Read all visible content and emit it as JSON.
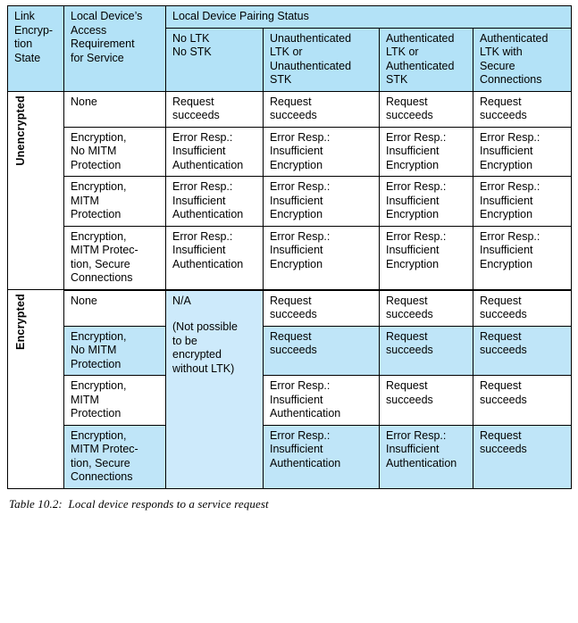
{
  "table": {
    "group_header": "Local Device Pairing Status",
    "columns": [
      {
        "key": "state",
        "label": "Link\nEncryp-\ntion\nState"
      },
      {
        "key": "access",
        "label": "Local Device’s\nAccess\nRequirement\nfor Service"
      },
      {
        "key": "no_ltk",
        "label": "No LTK\nNo STK"
      },
      {
        "key": "unauth",
        "label": "Unauthenticated\nLTK or\nUnauthenticated\nSTK"
      },
      {
        "key": "auth",
        "label": "Authenticated\nLTK or\nAuthenticated\nSTK"
      },
      {
        "key": "sc",
        "label": "Authenticated\nLTK with\nSecure\nConnections"
      }
    ],
    "sections": [
      {
        "state_label": "Unencrypted",
        "na_cell": null,
        "rows": [
          {
            "requirement": "None",
            "requirement_highlight": false,
            "cells": [
              {
                "text": "Request\nsucceeds",
                "highlight": false
              },
              {
                "text": "Request\nsucceeds",
                "highlight": false
              },
              {
                "text": "Request\nsucceeds",
                "highlight": false
              },
              {
                "text": "Request\nsucceeds",
                "highlight": false
              }
            ]
          },
          {
            "requirement": "Encryption,\nNo MITM\nProtection",
            "requirement_highlight": false,
            "cells": [
              {
                "text": "Error Resp.:\nInsufficient\nAuthentication",
                "highlight": false
              },
              {
                "text": "Error Resp.:\nInsufficient\nEncryption",
                "highlight": false
              },
              {
                "text": "Error Resp.:\nInsufficient\nEncryption",
                "highlight": false
              },
              {
                "text": "Error Resp.:\nInsufficient\nEncryption",
                "highlight": false
              }
            ]
          },
          {
            "requirement": "Encryption,\nMITM\nProtection",
            "requirement_highlight": false,
            "cells": [
              {
                "text": "Error Resp.:\nInsufficient\nAuthentication",
                "highlight": false
              },
              {
                "text": "Error Resp.:\nInsufficient\nEncryption",
                "highlight": false
              },
              {
                "text": "Error Resp.:\nInsufficient\nEncryption",
                "highlight": false
              },
              {
                "text": "Error Resp.:\nInsufficient\nEncryption",
                "highlight": false
              }
            ]
          },
          {
            "requirement": "Encryption,\nMITM Protec-\ntion, Secure\nConnections",
            "requirement_highlight": false,
            "cells": [
              {
                "text": "Error Resp.:\nInsufficient\nAuthentication",
                "highlight": false
              },
              {
                "text": "Error Resp.:\nInsufficient\nEncryption",
                "highlight": false
              },
              {
                "text": "Error Resp.:\nInsufficient\nEncryption",
                "highlight": false
              },
              {
                "text": "Error Resp.:\nInsufficient\nEncryption",
                "highlight": false
              }
            ]
          }
        ]
      },
      {
        "state_label": "Encrypted",
        "na_cell": "N/A",
        "na_note": "(Not possible\nto be\nencrypted\nwithout LTK)",
        "rows": [
          {
            "requirement": "None",
            "requirement_highlight": false,
            "cells": [
              {
                "text": "Request\nsucceeds",
                "highlight": false
              },
              {
                "text": "Request\nsucceeds",
                "highlight": false
              },
              {
                "text": "Request\nsucceeds",
                "highlight": false
              }
            ]
          },
          {
            "requirement": "Encryption,\nNo MITM\nProtection",
            "requirement_highlight": true,
            "cells": [
              {
                "text": "Request\nsucceeds",
                "highlight": true
              },
              {
                "text": "Request\nsucceeds",
                "highlight": true
              },
              {
                "text": "Request\nsucceeds",
                "highlight": true
              }
            ]
          },
          {
            "requirement": "Encryption,\nMITM\nProtection",
            "requirement_highlight": false,
            "cells": [
              {
                "text": "Error Resp.:\nInsufficient\nAuthentication",
                "highlight": false
              },
              {
                "text": "Request\nsucceeds",
                "highlight": false
              },
              {
                "text": "Request\nsucceeds",
                "highlight": false
              }
            ]
          },
          {
            "requirement": "Encryption,\nMITM Protec-\ntion, Secure\nConnections",
            "requirement_highlight": true,
            "cells": [
              {
                "text": "Error Resp.:\nInsufficient\nAuthentication",
                "highlight": true
              },
              {
                "text": "Error Resp.:\nInsufficient\nAuthentication",
                "highlight": true
              },
              {
                "text": "Request\nsucceeds",
                "highlight": true
              }
            ]
          }
        ]
      }
    ]
  },
  "caption": {
    "number": "Table 10.2:",
    "text": "Local device responds to a service request",
    "full": "Table 10.2:  Local device responds to a service request"
  },
  "colors": {
    "header_blue": "#b3e2f7",
    "highlight_blue": "#bfe5f8",
    "na_blue": "#cdeafb",
    "grid_black": "#000000",
    "header_rule_gray": "#8c8c8c",
    "page_white": "#ffffff"
  }
}
